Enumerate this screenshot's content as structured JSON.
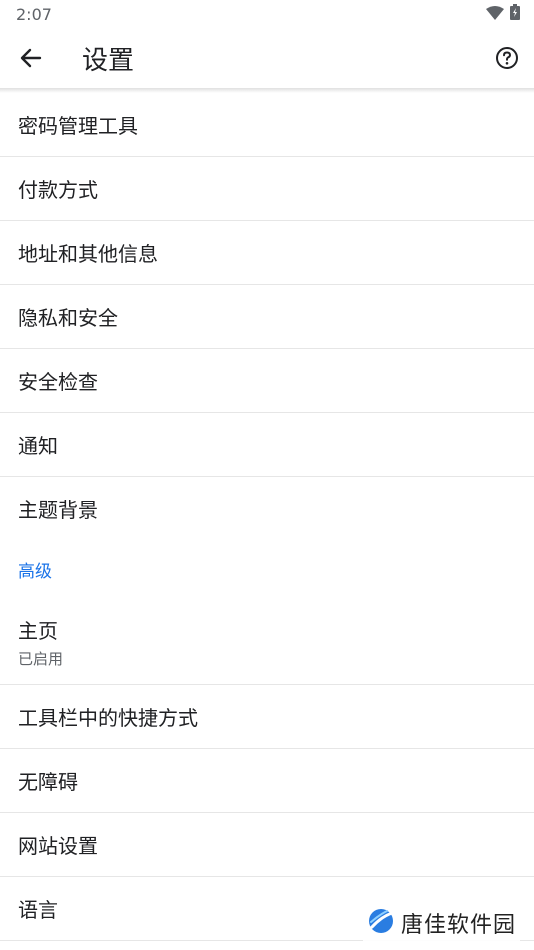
{
  "status_bar": {
    "time": "2:07"
  },
  "app_bar": {
    "title": "设置"
  },
  "settings_items": [
    {
      "label": "密码管理工具"
    },
    {
      "label": "付款方式"
    },
    {
      "label": "地址和其他信息"
    },
    {
      "label": "隐私和安全"
    },
    {
      "label": "安全检查"
    },
    {
      "label": "通知"
    },
    {
      "label": "主题背景"
    }
  ],
  "advanced": {
    "header": "高级",
    "homepage": {
      "label": "主页",
      "status": "已启用"
    },
    "items": [
      {
        "label": "工具栏中的快捷方式"
      },
      {
        "label": "无障碍"
      },
      {
        "label": "网站设置"
      },
      {
        "label": "语言"
      }
    ]
  },
  "watermark": {
    "text": "唐佳软件园"
  },
  "colors": {
    "accent": "#1a73e8",
    "text": "#202124",
    "divider": "#e6e6e6"
  }
}
